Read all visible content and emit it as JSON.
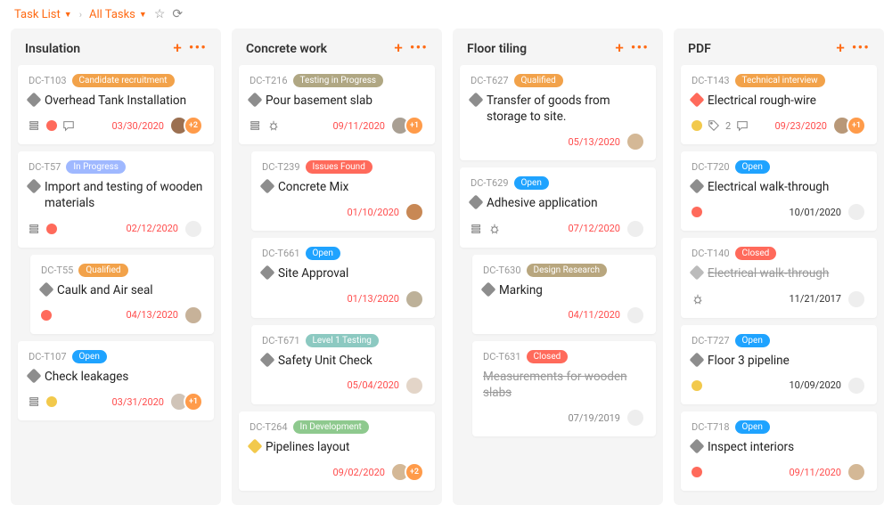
{
  "breadcrumb": {
    "a": "Task List",
    "b": "All Tasks"
  },
  "columns": [
    {
      "title": "Insulation",
      "cards": [
        {
          "id": "DC-T103",
          "tag": {
            "text": "Candidate recruitment",
            "bg": "#f2a24a"
          },
          "prio": "#8d8d8d",
          "title": "Overhead Tank Installation",
          "icons": [
            "subtask",
            "alert",
            "comment"
          ],
          "date": "03/30/2020",
          "dateColor": "#ff4d4d",
          "av": [
            {
              "bg": "#9b7051"
            },
            {
              "badge": "+2"
            }
          ]
        },
        {
          "id": "DC-T57",
          "tag": {
            "text": "In Progress",
            "bg": "#9fb8ff"
          },
          "prio": "#8d8d8d",
          "title": "Import and testing of wooden materials",
          "icons": [
            "subtask",
            "alert"
          ],
          "date": "02/12/2020",
          "dateColor": "#ff4d4d",
          "av": [
            {
              "empty": true
            }
          ]
        },
        {
          "nested": true,
          "id": "DC-T55",
          "tag": {
            "text": "Qualified",
            "bg": "#f2a24a"
          },
          "prio": "#8d8d8d",
          "title": "Caulk and Air seal",
          "icons": [
            "alert"
          ],
          "date": "04/13/2020",
          "dateColor": "#ff4d4d",
          "av": [
            {
              "bg": "#c7b299"
            }
          ]
        },
        {
          "id": "DC-T107",
          "tag": {
            "text": "Open",
            "bg": "#1fa3ff"
          },
          "prio": "#8d8d8d",
          "title": "Check leakages",
          "icons": [
            "subtask",
            "dot-amber"
          ],
          "date": "03/31/2020",
          "dateColor": "#ff4d4d",
          "av": [
            {
              "bg": "#d0c4b8"
            },
            {
              "badge": "+1"
            }
          ]
        }
      ]
    },
    {
      "title": "Concrete work",
      "cards": [
        {
          "id": "DC-T216",
          "tag": {
            "text": "Testing in Progress",
            "bg": "#b0a783"
          },
          "prio": "#8d8d8d",
          "title": "Pour basement slab",
          "icons": [
            "subtask",
            "bug"
          ],
          "date": "09/11/2020",
          "dateColor": "#ff4d4d",
          "av": [
            {
              "bg": "#a99f93"
            },
            {
              "badge": "+1"
            }
          ]
        },
        {
          "nested": true,
          "id": "DC-T239",
          "tag": {
            "text": "Issues Found",
            "bg": "#ff6a5b"
          },
          "prio": "#8d8d8d",
          "title": "Concrete Mix",
          "icons": [],
          "date": "01/10/2020",
          "dateColor": "#ff4d4d",
          "av": [
            {
              "bg": "#c88855"
            }
          ]
        },
        {
          "nested": true,
          "id": "DC-T661",
          "tag": {
            "text": "Open",
            "bg": "#1fa3ff"
          },
          "prio": "#8d8d8d",
          "title": "Site Approval",
          "icons": [],
          "date": "01/13/2020",
          "dateColor": "#ff4d4d",
          "av": [
            {
              "bg": "#bdb199"
            }
          ]
        },
        {
          "nested": true,
          "id": "DC-T671",
          "tag": {
            "text": "Level 1 Testing",
            "bg": "#8cc9c1"
          },
          "prio": "#8d8d8d",
          "title": "Safety Unit Check",
          "icons": [],
          "date": "05/04/2020",
          "dateColor": "#ff4d4d",
          "av": [
            {
              "bg": "#e3d5c8"
            }
          ]
        },
        {
          "id": "DC-T264",
          "tag": {
            "text": "In Development",
            "bg": "#8ec98e"
          },
          "prio": "#f2c94c",
          "title": "Pipelines layout",
          "icons": [],
          "date": "09/02/2020",
          "dateColor": "#ff4d4d",
          "av": [
            {
              "bg": "#d4b896"
            },
            {
              "badge": "+2"
            }
          ]
        }
      ]
    },
    {
      "title": "Floor tiling",
      "cards": [
        {
          "id": "DC-T627",
          "tag": {
            "text": "Qualified",
            "bg": "#f2a24a"
          },
          "prio": "#8d8d8d",
          "title": "Transfer of goods from storage to site.",
          "icons": [],
          "date": "05/13/2020",
          "dateColor": "#ff4d4d",
          "av": [
            {
              "bg": "#d4b896"
            }
          ]
        },
        {
          "id": "DC-T629",
          "tag": {
            "text": "Open",
            "bg": "#1fa3ff"
          },
          "prio": "#8d8d8d",
          "title": "Adhesive application",
          "icons": [
            "subtask",
            "bug"
          ],
          "date": "07/12/2020",
          "dateColor": "#ff4d4d",
          "av": [
            {
              "empty": true
            }
          ]
        },
        {
          "nested": true,
          "id": "DC-T630",
          "tag": {
            "text": "Design Research",
            "bg": "#b8a67e"
          },
          "prio": "#8d8d8d",
          "title": "Marking",
          "icons": [],
          "date": "04/11/2020",
          "dateColor": "#ff4d4d",
          "av": [
            {
              "empty": true
            }
          ]
        },
        {
          "nested": true,
          "id": "DC-T631",
          "tag": {
            "text": "Closed",
            "bg": "#ff6a5b"
          },
          "prio": null,
          "title": "Measurements for wooden slabs",
          "strike": true,
          "icons": [],
          "date": "07/19/2019",
          "dateColor": "#888",
          "av": [
            {
              "empty": true
            }
          ]
        }
      ]
    },
    {
      "title": "PDF",
      "cards": [
        {
          "id": "DC-T143",
          "tag": {
            "text": "Technical interview",
            "bg": "#f2a24a"
          },
          "prio": "#ff6a5b",
          "title": "Electrical rough-wire",
          "icons": [
            "dot-amber",
            "tag",
            "comment"
          ],
          "tagCount": "2",
          "date": "09/23/2020",
          "dateColor": "#ff4d4d",
          "av": [
            {
              "bg": "#b89878"
            },
            {
              "badge": "+1"
            }
          ]
        },
        {
          "id": "DC-T720",
          "tag": {
            "text": "Open",
            "bg": "#1fa3ff"
          },
          "prio": "#8d8d8d",
          "title": "Electrical walk-through",
          "icons": [
            "alert"
          ],
          "date": "10/01/2020",
          "dateColor": "#333",
          "av": [
            {
              "empty": true
            }
          ]
        },
        {
          "id": "DC-T140",
          "tag": {
            "text": "Closed",
            "bg": "#ff6a5b"
          },
          "prio": "#bbb",
          "title": "Electrical walk-through",
          "strike": true,
          "icons": [
            "bug"
          ],
          "date": "11/21/2017",
          "dateColor": "#333",
          "av": [
            {
              "empty": true
            }
          ]
        },
        {
          "id": "DC-T727",
          "tag": {
            "text": "Open",
            "bg": "#1fa3ff"
          },
          "prio": "#8d8d8d",
          "title": "Floor 3 pipeline",
          "icons": [
            "dot-amber"
          ],
          "date": "10/09/2020",
          "dateColor": "#333",
          "av": [
            {
              "empty": true
            }
          ]
        },
        {
          "id": "DC-T718",
          "tag": {
            "text": "Open",
            "bg": "#1fa3ff"
          },
          "prio": "#8d8d8d",
          "title": "Inspect interiors",
          "icons": [
            "alert"
          ],
          "date": "09/11/2020",
          "dateColor": "#ff4d4d",
          "av": [
            {
              "bg": "#d4b896"
            }
          ]
        }
      ]
    }
  ]
}
